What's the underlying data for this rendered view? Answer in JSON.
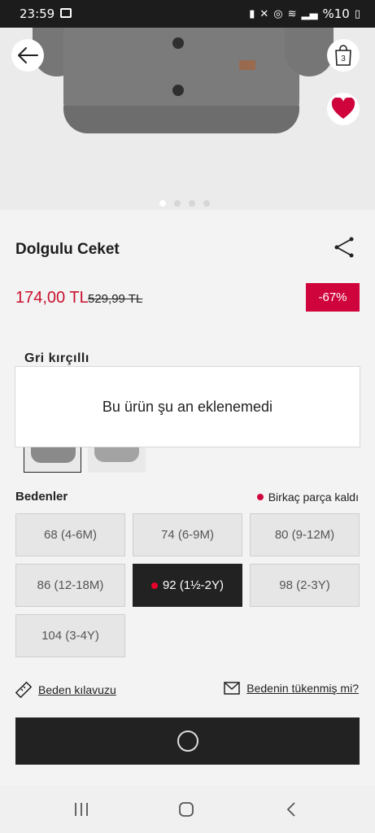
{
  "status_bar": {
    "time": "23:59",
    "battery": "%10"
  },
  "product": {
    "title": "Dolgulu Ceket",
    "price": "174,00 TL",
    "old_price": "529,99 TL",
    "discount": "-67%",
    "color_name": "Gri kırçıllı",
    "image_count": 4,
    "active_image_index": 0
  },
  "cart": {
    "count": "3"
  },
  "toast": {
    "message": "Bu ürün şu an eklenemedi"
  },
  "sizes": {
    "label": "Bedenler",
    "stock_note": "Birkaç parça kaldı",
    "items": [
      {
        "label": "68 (4-6M)"
      },
      {
        "label": "74 (6-9M)"
      },
      {
        "label": "80 (9-12M)"
      },
      {
        "label": "86 (12-18M)"
      },
      {
        "label": "92 (1½-2Y)",
        "selected": true
      },
      {
        "label": "98 (2-3Y)"
      },
      {
        "label": "104 (3-4Y)"
      }
    ]
  },
  "links": {
    "size_guide": "Beden kılavuzu",
    "size_sold_out": "Bedenin tükenmiş mi?"
  },
  "icons": {
    "back": "arrow-left-icon",
    "bag": "shopping-bag-icon",
    "favorite": "heart-icon",
    "share": "share-icon",
    "ruler": "ruler-icon",
    "mail": "envelope-icon",
    "loading": "spinner-icon"
  },
  "colors": {
    "accent_red": "#d0043c",
    "price_red": "#c8102e",
    "dark": "#222222"
  }
}
